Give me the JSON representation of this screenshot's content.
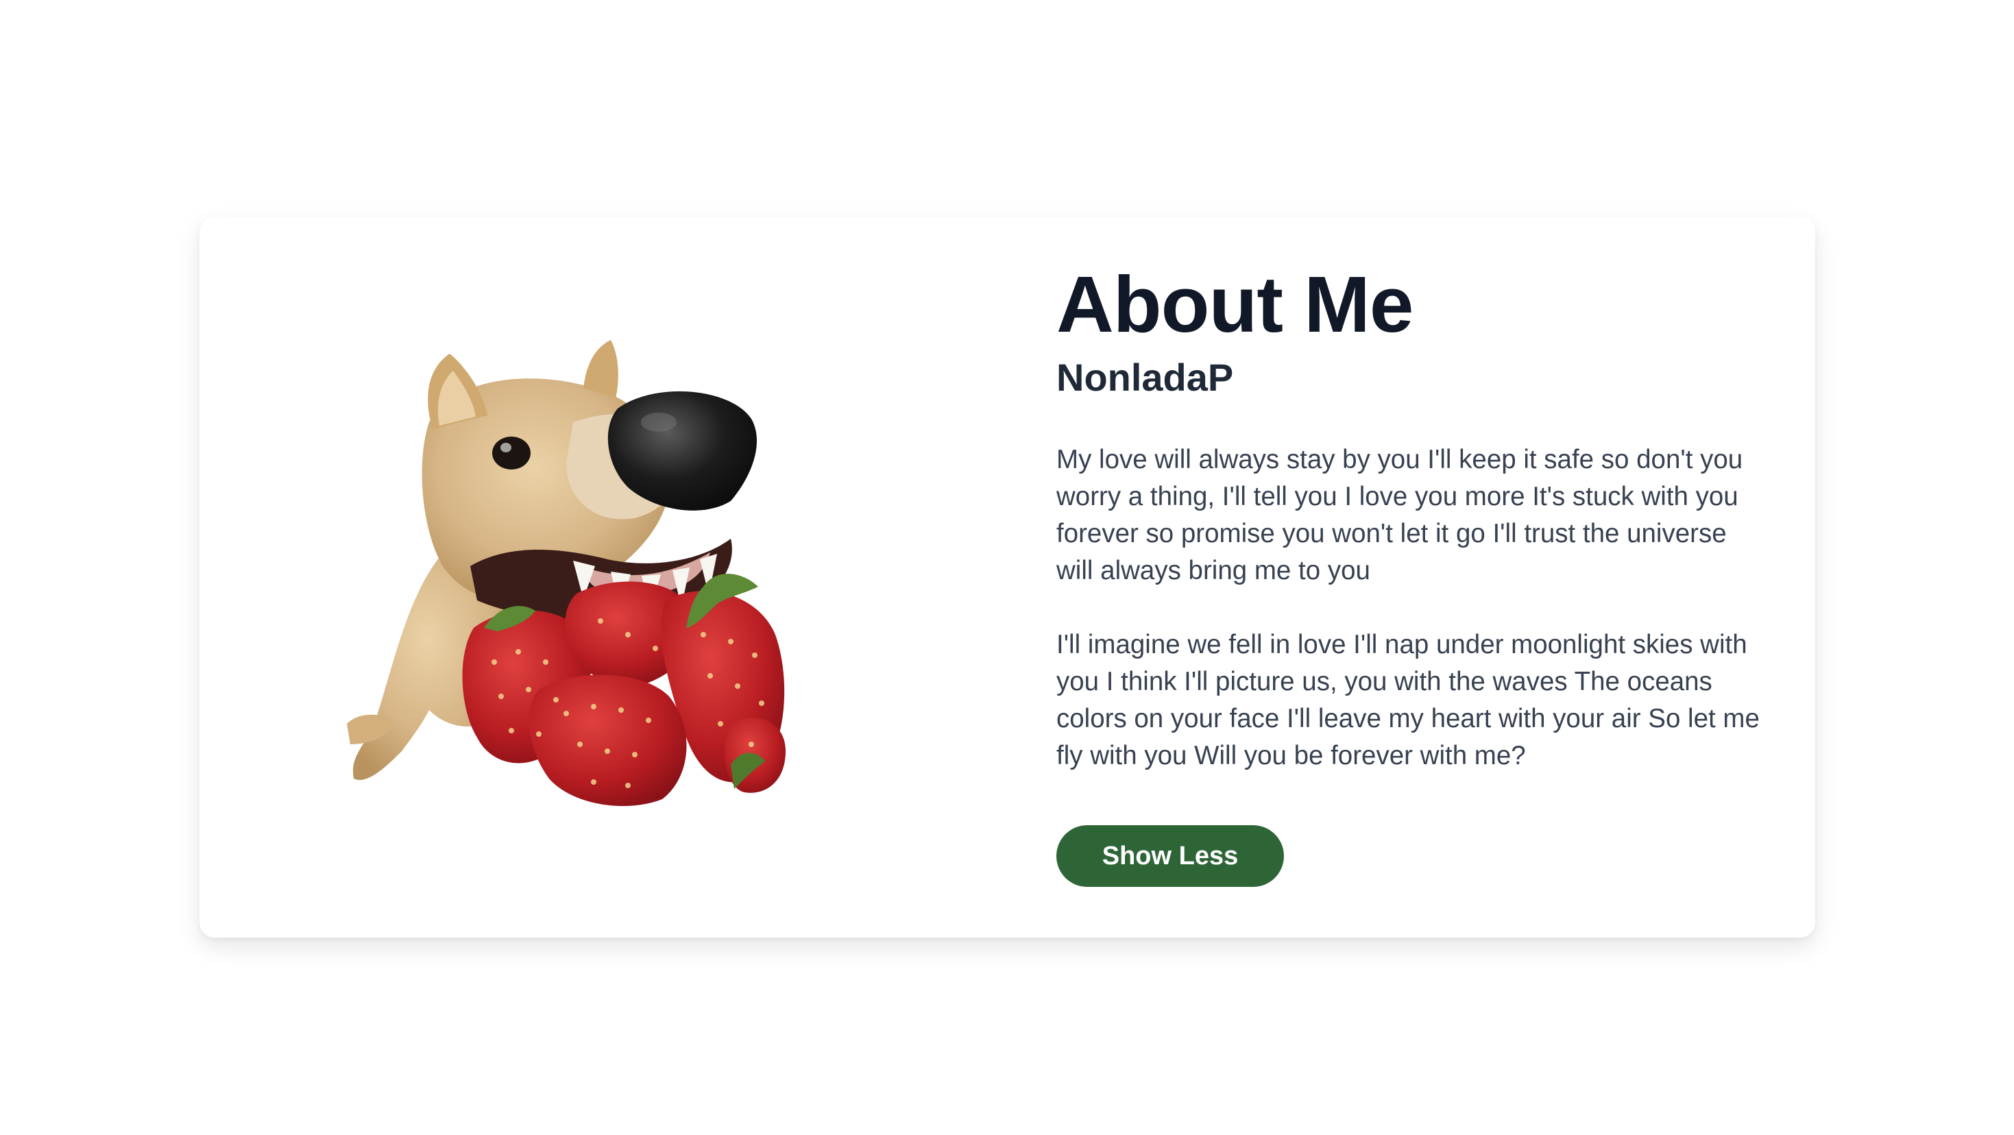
{
  "about": {
    "title": "About Me",
    "name": "NonladaP",
    "paragraphs": [
      "My love will always stay by you I'll keep it safe so don't you worry a thing, I'll tell you I love you more It's stuck with you forever so promise you won't let it go I'll trust the universe will always bring me to you",
      "I'll imagine we fell in love I'll nap under moonlight skies with you I think I'll picture us, you with the waves The oceans colors on your face I'll leave my heart with your air So let me fly with you Will you be forever with me?"
    ],
    "toggle_label": "Show Less"
  },
  "theme": {
    "button_color": "#2e6537",
    "heading_color": "#111827",
    "text_color": "#374151",
    "background": "#ffffff"
  }
}
